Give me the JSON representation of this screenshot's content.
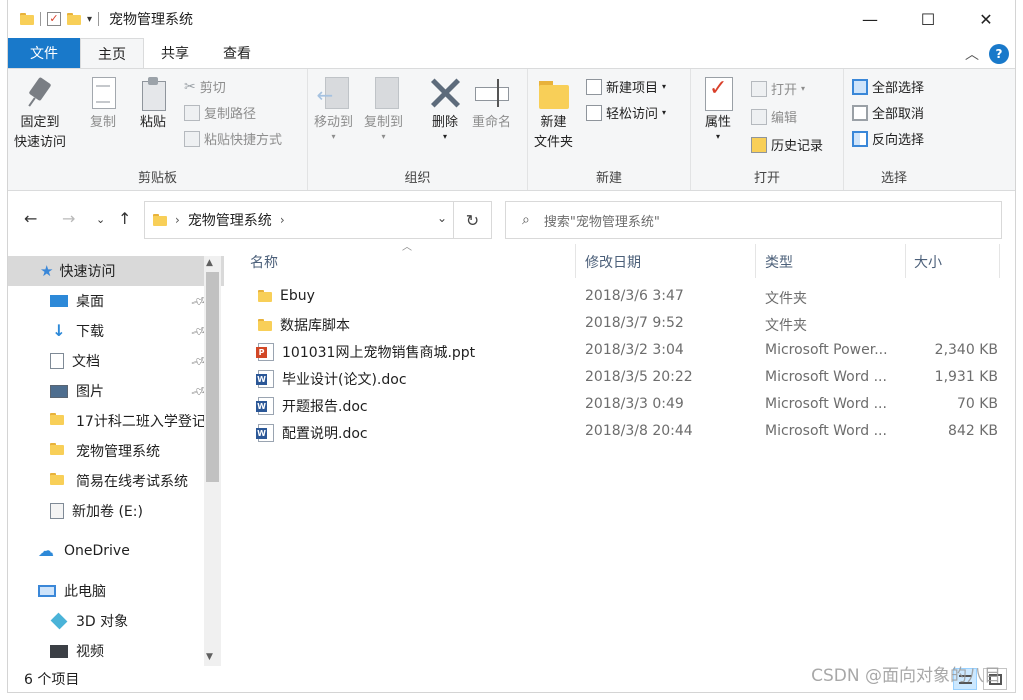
{
  "window": {
    "title": "宠物管理系统",
    "controls": {
      "minimize": "—",
      "maximize": "☐",
      "close": "✕"
    }
  },
  "tabs": [
    {
      "label": "文件"
    },
    {
      "label": "主页"
    },
    {
      "label": "共享"
    },
    {
      "label": "查看"
    }
  ],
  "ribbon": {
    "clipboard": {
      "label": "剪贴板",
      "pin_line1": "固定到",
      "pin_line2": "快速访问",
      "copy": "复制",
      "paste": "粘贴",
      "cut": "剪切",
      "copy_path": "复制路径",
      "paste_shortcut": "粘贴快捷方式"
    },
    "organize": {
      "label": "组织",
      "move_to": "移动到",
      "copy_to": "复制到",
      "delete": "删除",
      "rename": "重命名"
    },
    "new": {
      "label": "新建",
      "new_folder_line1": "新建",
      "new_folder_line2": "文件夹",
      "new_item": "新建项目",
      "easy_access": "轻松访问"
    },
    "open": {
      "label": "打开",
      "properties": "属性",
      "open": "打开",
      "edit": "编辑",
      "history": "历史记录"
    },
    "select": {
      "label": "选择",
      "select_all": "全部选择",
      "select_none": "全部取消",
      "invert": "反向选择"
    }
  },
  "address": {
    "path": "宠物管理系统",
    "search_placeholder": "搜索\"宠物管理系统\""
  },
  "nav": {
    "quick_access": "快速访问",
    "items": [
      {
        "label": "桌面",
        "pinned": true
      },
      {
        "label": "下载",
        "pinned": true
      },
      {
        "label": "文档",
        "pinned": true
      },
      {
        "label": "图片",
        "pinned": true
      },
      {
        "label": "17计科二班入学登记"
      },
      {
        "label": "宠物管理系统"
      },
      {
        "label": "简易在线考试系统"
      },
      {
        "label": "新加卷 (E:)"
      }
    ],
    "onedrive": "OneDrive",
    "this_pc": "此电脑",
    "objects3d": "3D 对象",
    "videos": "视频"
  },
  "columns": {
    "name": "名称",
    "date": "修改日期",
    "type": "类型",
    "size": "大小"
  },
  "files": [
    {
      "name": "Ebuy",
      "date": "2018/3/6 3:47",
      "type": "文件夹",
      "size": "",
      "icon": "folder-icon"
    },
    {
      "name": "数据库脚本",
      "date": "2018/3/7 9:52",
      "type": "文件夹",
      "size": "",
      "icon": "folder-icon"
    },
    {
      "name": "101031网上宠物销售商城.ppt",
      "date": "2018/3/2 3:04",
      "type": "Microsoft Power...",
      "size": "2,340 KB",
      "icon": "ppt-icon"
    },
    {
      "name": "毕业设计(论文).doc",
      "date": "2018/3/5 20:22",
      "type": "Microsoft Word ...",
      "size": "1,931 KB",
      "icon": "doc-icon"
    },
    {
      "name": "开题报告.doc",
      "date": "2018/3/3 0:49",
      "type": "Microsoft Word ...",
      "size": "70 KB",
      "icon": "doc-icon"
    },
    {
      "name": "配置说明.doc",
      "date": "2018/3/8 20:44",
      "type": "Microsoft Word ...",
      "size": "842 KB",
      "icon": "doc-icon"
    }
  ],
  "status": {
    "count": "6 个项目"
  },
  "watermark": "CSDN @面向对象的八目"
}
